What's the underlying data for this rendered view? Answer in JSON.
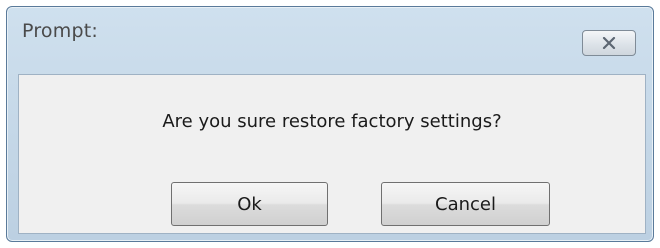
{
  "dialog": {
    "title": "Prompt:",
    "message": "Are you sure restore factory settings?",
    "close_icon": "close-x-icon"
  },
  "buttons": {
    "ok_label": "Ok",
    "cancel_label": "Cancel"
  },
  "colors": {
    "frame": "#bcd0e2",
    "client_background": "#f0f0f0",
    "title_text": "#4a4a4a"
  }
}
